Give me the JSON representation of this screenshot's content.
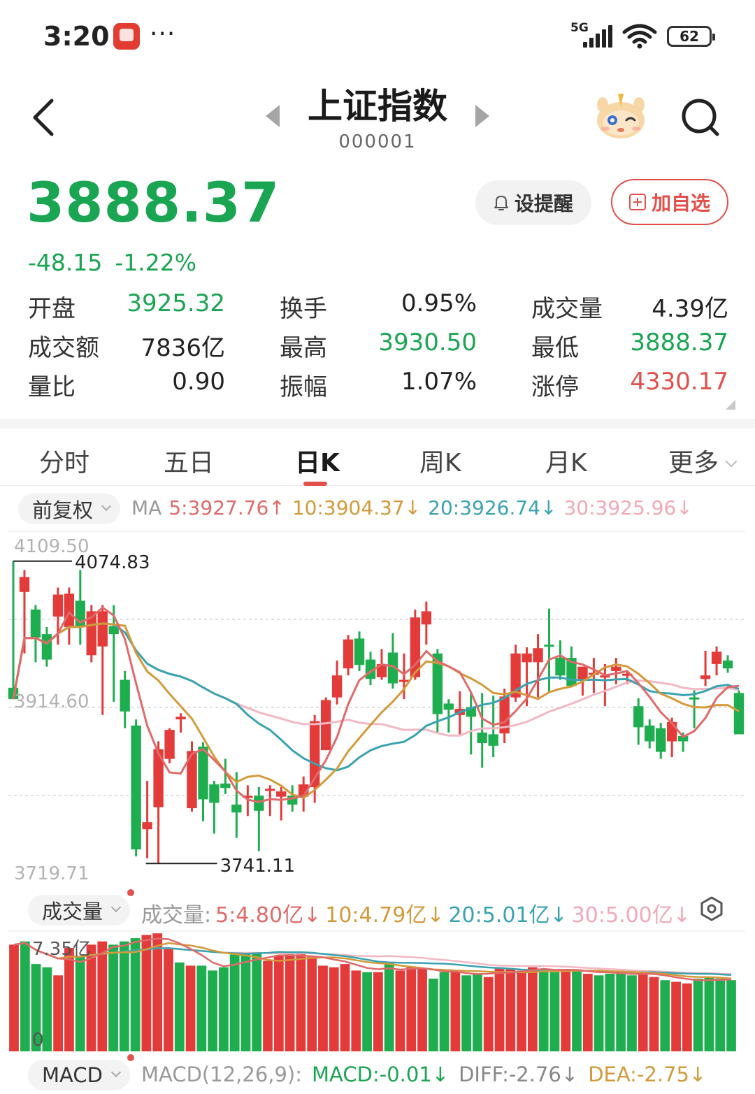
{
  "status_bar": {
    "time": "3:20",
    "network": "5G",
    "battery": "62",
    "more": "···"
  },
  "header": {
    "title": "上证指数",
    "code": "000001"
  },
  "quote": {
    "price": "3888.37",
    "change": "-48.15",
    "change_pct": "-1.22%",
    "alert_label": "设提醒",
    "watchlist_label": "加自选"
  },
  "stats": [
    [
      {
        "label": "开盘",
        "value": "3925.32",
        "tone": "green"
      },
      {
        "label": "换手",
        "value": "0.95%",
        "tone": "plain"
      },
      {
        "label": "成交量",
        "value": "4.39亿",
        "tone": "plain"
      }
    ],
    [
      {
        "label": "成交额",
        "value": "7836亿",
        "tone": "plain"
      },
      {
        "label": "最高",
        "value": "3930.50",
        "tone": "green"
      },
      {
        "label": "最低",
        "value": "3888.37",
        "tone": "green"
      }
    ],
    [
      {
        "label": "量比",
        "value": "0.90",
        "tone": "plain"
      },
      {
        "label": "振幅",
        "value": "1.07%",
        "tone": "plain"
      },
      {
        "label": "涨停",
        "value": "4330.17",
        "tone": "red"
      }
    ]
  ],
  "tabs": [
    "分时",
    "五日",
    "日K",
    "周K",
    "月K",
    "更多"
  ],
  "active_tab": "日K",
  "ma_bar": {
    "adjust_label": "前复权",
    "prefix": "MA",
    "items": [
      {
        "text": "5:3927.76↑",
        "color": "#e06a6a"
      },
      {
        "text": "10:3904.37↓",
        "color": "#d49a3a"
      },
      {
        "text": "20:3926.74↓",
        "color": "#3aa3b0"
      },
      {
        "text": "30:3925.96↓",
        "color": "#f2a8b8"
      }
    ]
  },
  "colors": {
    "up": "#e33a3a",
    "down": "#1fae4f",
    "ma5": "#e06a6a",
    "ma10": "#d49a3a",
    "ma20": "#3aa3b0",
    "ma30": "#f2b8c4"
  },
  "chart_data": [
    {
      "type": "candlestick",
      "title": "",
      "y_ticks": [
        "4109.50",
        "3914.60",
        "3719.71"
      ],
      "ylim": [
        3719.71,
        4109.5
      ],
      "annotations": [
        {
          "label": "4074.83",
          "kind": "high"
        },
        {
          "label": "3741.11",
          "kind": "low"
        }
      ],
      "candles": [
        {
          "o": 3941,
          "c": 3928,
          "h": 4085,
          "l": 3940
        },
        {
          "o": 4050,
          "c": 4067,
          "h": 4075,
          "l": 3980
        },
        {
          "o": 4030,
          "c": 3998,
          "h": 4035,
          "l": 3970
        },
        {
          "o": 4002,
          "c": 3973,
          "h": 4010,
          "l": 3965
        },
        {
          "o": 4022,
          "c": 4047,
          "h": 4055,
          "l": 3990
        },
        {
          "o": 4010,
          "c": 4048,
          "h": 4055,
          "l": 3990
        },
        {
          "o": 4040,
          "c": 4010,
          "h": 4075,
          "l": 3990
        },
        {
          "o": 3978,
          "c": 4028,
          "h": 4035,
          "l": 3970
        },
        {
          "o": 3988,
          "c": 4028,
          "h": 4035,
          "l": 3910
        },
        {
          "o": 4011,
          "c": 4002,
          "h": 4035,
          "l": 3925
        },
        {
          "o": 3950,
          "c": 3914,
          "h": 3960,
          "l": 3895
        },
        {
          "o": 3898,
          "c": 3757,
          "h": 3905,
          "l": 3749
        },
        {
          "o": 3780,
          "c": 3788,
          "h": 3835,
          "l": 3747
        },
        {
          "o": 3805,
          "c": 3871,
          "h": 3880,
          "l": 3741
        },
        {
          "o": 3860,
          "c": 3893,
          "h": 3895,
          "l": 3855
        },
        {
          "o": 3905,
          "c": 3908,
          "h": 3912,
          "l": 3890
        },
        {
          "o": 3804,
          "c": 3869,
          "h": 3880,
          "l": 3800
        },
        {
          "o": 3874,
          "c": 3814,
          "h": 3879,
          "l": 3789
        },
        {
          "o": 3831,
          "c": 3810,
          "h": 3835,
          "l": 3775
        },
        {
          "o": 3832,
          "c": 3827,
          "h": 3860,
          "l": 3820
        },
        {
          "o": 3808,
          "c": 3799,
          "h": 3845,
          "l": 3770
        },
        {
          "o": 3818,
          "c": 3818,
          "h": 3830,
          "l": 3795
        },
        {
          "o": 3818,
          "c": 3801,
          "h": 3828,
          "l": 3755
        },
        {
          "o": 3825,
          "c": 3826,
          "h": 3830,
          "l": 3795
        },
        {
          "o": 3817,
          "c": 3823,
          "h": 3828,
          "l": 3790
        },
        {
          "o": 3818,
          "c": 3808,
          "h": 3830,
          "l": 3800
        },
        {
          "o": 3817,
          "c": 3831,
          "h": 3840,
          "l": 3800
        },
        {
          "o": 3828,
          "c": 3903,
          "h": 3910,
          "l": 3810
        },
        {
          "o": 3870,
          "c": 3927,
          "h": 3930,
          "l": 3870
        },
        {
          "o": 3930,
          "c": 3955,
          "h": 3972,
          "l": 3922
        },
        {
          "o": 3963,
          "c": 3996,
          "h": 4001,
          "l": 3955
        },
        {
          "o": 3997,
          "c": 3967,
          "h": 4005,
          "l": 3960
        },
        {
          "o": 3973,
          "c": 3951,
          "h": 3982,
          "l": 3944
        },
        {
          "o": 3953,
          "c": 3968,
          "h": 3985,
          "l": 3950
        },
        {
          "o": 3981,
          "c": 3946,
          "h": 4003,
          "l": 3940
        },
        {
          "o": 3950,
          "c": 3950,
          "h": 3980,
          "l": 3928
        },
        {
          "o": 3953,
          "c": 4021,
          "h": 4030,
          "l": 3950
        },
        {
          "o": 4013,
          "c": 4028,
          "h": 4039,
          "l": 3990
        },
        {
          "o": 3980,
          "c": 3911,
          "h": 3985,
          "l": 3890
        },
        {
          "o": 3923,
          "c": 3916,
          "h": 3928,
          "l": 3890
        },
        {
          "o": 3910,
          "c": 3917,
          "h": 3937,
          "l": 3888
        },
        {
          "o": 3919,
          "c": 3908,
          "h": 3935,
          "l": 3865
        },
        {
          "o": 3890,
          "c": 3878,
          "h": 3935,
          "l": 3850
        },
        {
          "o": 3888,
          "c": 3875,
          "h": 3932,
          "l": 3862
        },
        {
          "o": 3889,
          "c": 3931,
          "h": 3940,
          "l": 3878
        },
        {
          "o": 3930,
          "c": 3980,
          "h": 3990,
          "l": 3925
        },
        {
          "o": 3970,
          "c": 3980,
          "h": 3987,
          "l": 3920
        },
        {
          "o": 3970,
          "c": 3986,
          "h": 4002,
          "l": 3930
        },
        {
          "o": 3990,
          "c": 3988,
          "h": 4031,
          "l": 3935
        },
        {
          "o": 3975,
          "c": 3955,
          "h": 3995,
          "l": 3950
        },
        {
          "o": 3975,
          "c": 3943,
          "h": 3988,
          "l": 3960
        },
        {
          "o": 3950,
          "c": 3965,
          "h": 3965,
          "l": 3932
        },
        {
          "o": 3956,
          "c": 3958,
          "h": 3975,
          "l": 3935
        },
        {
          "o": 3953,
          "c": 3955,
          "h": 3968,
          "l": 3920
        },
        {
          "o": 3960,
          "c": 3965,
          "h": 3975,
          "l": 3945
        },
        {
          "o": 3955,
          "c": 3957,
          "h": 3960,
          "l": 3945
        },
        {
          "o": 3920,
          "c": 3896,
          "h": 3929,
          "l": 3876
        },
        {
          "o": 3898,
          "c": 3880,
          "h": 3905,
          "l": 3872
        },
        {
          "o": 3895,
          "c": 3868,
          "h": 3901,
          "l": 3860
        },
        {
          "o": 3880,
          "c": 3902,
          "h": 3907,
          "l": 3862
        },
        {
          "o": 3886,
          "c": 3880,
          "h": 3890,
          "l": 3868
        },
        {
          "o": 3930,
          "c": 3928,
          "h": 3938,
          "l": 3895
        },
        {
          "o": 3951,
          "c": 3955,
          "h": 3983,
          "l": 3943
        },
        {
          "o": 3968,
          "c": 3982,
          "h": 3988,
          "l": 3955
        },
        {
          "o": 3972,
          "c": 3963,
          "h": 3978,
          "l": 3958
        },
        {
          "o": 3935,
          "c": 3888,
          "h": 3938,
          "l": 3888
        }
      ]
    },
    {
      "type": "bar",
      "title": "成交量",
      "y_ticks": [
        "7.35亿",
        "0"
      ],
      "ma_items": [
        {
          "text": "5:4.80亿↓",
          "color": "#e06a6a"
        },
        {
          "text": "10:4.79亿↓",
          "color": "#d49a3a"
        },
        {
          "text": "20:5.01亿↓",
          "color": "#3aa3b0"
        },
        {
          "text": "30:5.00亿↓",
          "color": "#f2a8b8"
        }
      ],
      "values": [
        6.6,
        6.8,
        5.4,
        5.2,
        4.7,
        6.4,
        5.9,
        6.6,
        6.8,
        6.6,
        6.8,
        7.0,
        7.2,
        7.3,
        6.4,
        5.5,
        5.3,
        5.3,
        5.0,
        5.2,
        6.0,
        6.1,
        6.1,
        5.6,
        5.9,
        6.0,
        6.0,
        5.9,
        5.3,
        5.2,
        5.4,
        5.0,
        4.9,
        4.9,
        5.5,
        5.0,
        5.2,
        5.1,
        4.5,
        4.9,
        5.0,
        4.7,
        4.8,
        4.6,
        5.2,
        5.1,
        5.0,
        5.2,
        5.0,
        4.9,
        5.1,
        5.0,
        4.8,
        4.7,
        4.8,
        4.9,
        4.7,
        4.9,
        4.6,
        4.4,
        4.3,
        4.2,
        4.5,
        4.6,
        4.5,
        4.4
      ],
      "up_flags": [
        1,
        0,
        0,
        0,
        1,
        1,
        0,
        1,
        1,
        0,
        0,
        0,
        1,
        1,
        1,
        0,
        1,
        0,
        0,
        0,
        0,
        0,
        0,
        1,
        1,
        1,
        1,
        1,
        1,
        1,
        1,
        1,
        0,
        1,
        0,
        1,
        1,
        1,
        0,
        0,
        1,
        0,
        0,
        1,
        1,
        1,
        1,
        1,
        0,
        0,
        1,
        0,
        1,
        0,
        0,
        0,
        0,
        1,
        1,
        0,
        1,
        1,
        0,
        0,
        0,
        0
      ]
    }
  ],
  "volume_bar": {
    "label": "成交量",
    "prefix": "成交量:"
  },
  "macd_bar": {
    "label": "MACD",
    "params": "MACD(12,26,9):",
    "macd": "MACD:-0.01↓",
    "diff": "DIFF:-2.76↓",
    "dea": "DEA:-2.75↓"
  }
}
